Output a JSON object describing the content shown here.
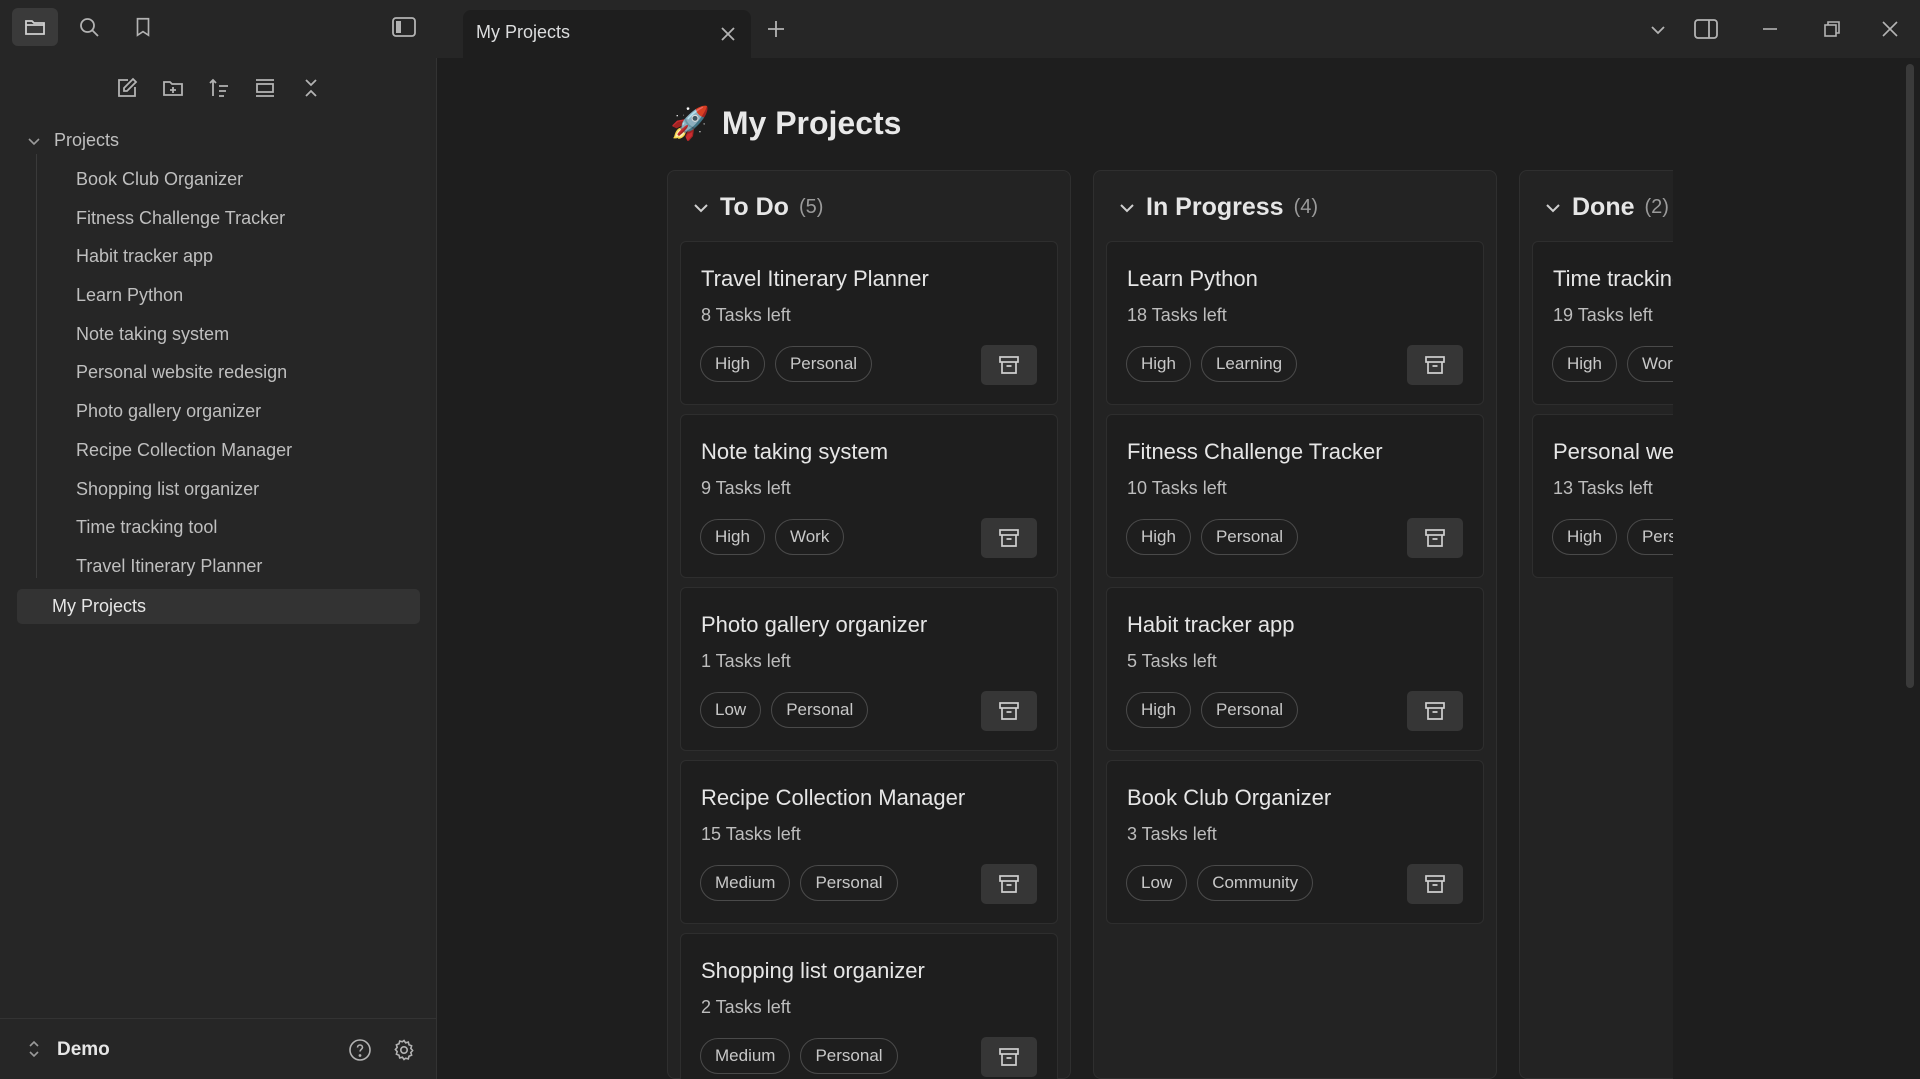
{
  "tab": {
    "title": "My Projects"
  },
  "sidebar": {
    "folder": "Projects",
    "items": [
      "Book Club Organizer",
      "Fitness Challenge Tracker",
      "Habit tracker app",
      "Learn Python",
      "Note taking system",
      "Personal website redesign",
      "Photo gallery organizer",
      "Recipe Collection Manager",
      "Shopping list organizer",
      "Time tracking tool",
      "Travel Itinerary Planner"
    ],
    "active_file": "My Projects",
    "vault": "Demo"
  },
  "page": {
    "title": "My Projects",
    "emoji": "🚀"
  },
  "board": {
    "columns": [
      {
        "title": "To Do",
        "count": "(5)",
        "cards": [
          {
            "title": "Travel Itinerary Planner",
            "tasks": "8 Tasks left",
            "tags": [
              "High",
              "Personal"
            ]
          },
          {
            "title": "Note taking system",
            "tasks": "9 Tasks left",
            "tags": [
              "High",
              "Work"
            ]
          },
          {
            "title": "Photo gallery organizer",
            "tasks": "1 Tasks left",
            "tags": [
              "Low",
              "Personal"
            ]
          },
          {
            "title": "Recipe Collection Manager",
            "tasks": "15 Tasks left",
            "tags": [
              "Medium",
              "Personal"
            ]
          },
          {
            "title": "Shopping list organizer",
            "tasks": "2 Tasks left",
            "tags": [
              "Medium",
              "Personal"
            ]
          }
        ]
      },
      {
        "title": "In Progress",
        "count": "(4)",
        "cards": [
          {
            "title": "Learn Python",
            "tasks": "18 Tasks left",
            "tags": [
              "High",
              "Learning"
            ]
          },
          {
            "title": "Fitness Challenge Tracker",
            "tasks": "10 Tasks left",
            "tags": [
              "High",
              "Personal"
            ]
          },
          {
            "title": "Habit tracker app",
            "tasks": "5 Tasks left",
            "tags": [
              "High",
              "Personal"
            ]
          },
          {
            "title": "Book Club Organizer",
            "tasks": "3 Tasks left",
            "tags": [
              "Low",
              "Community"
            ]
          }
        ]
      },
      {
        "title": "Done",
        "count": "(2)",
        "cards": [
          {
            "title": "Time tracking tool",
            "tasks": "19 Tasks left",
            "tags": [
              "High",
              "Work"
            ]
          },
          {
            "title": "Personal website redesign",
            "tasks": "13 Tasks left",
            "tags": [
              "High",
              "Personal"
            ]
          }
        ]
      }
    ]
  }
}
